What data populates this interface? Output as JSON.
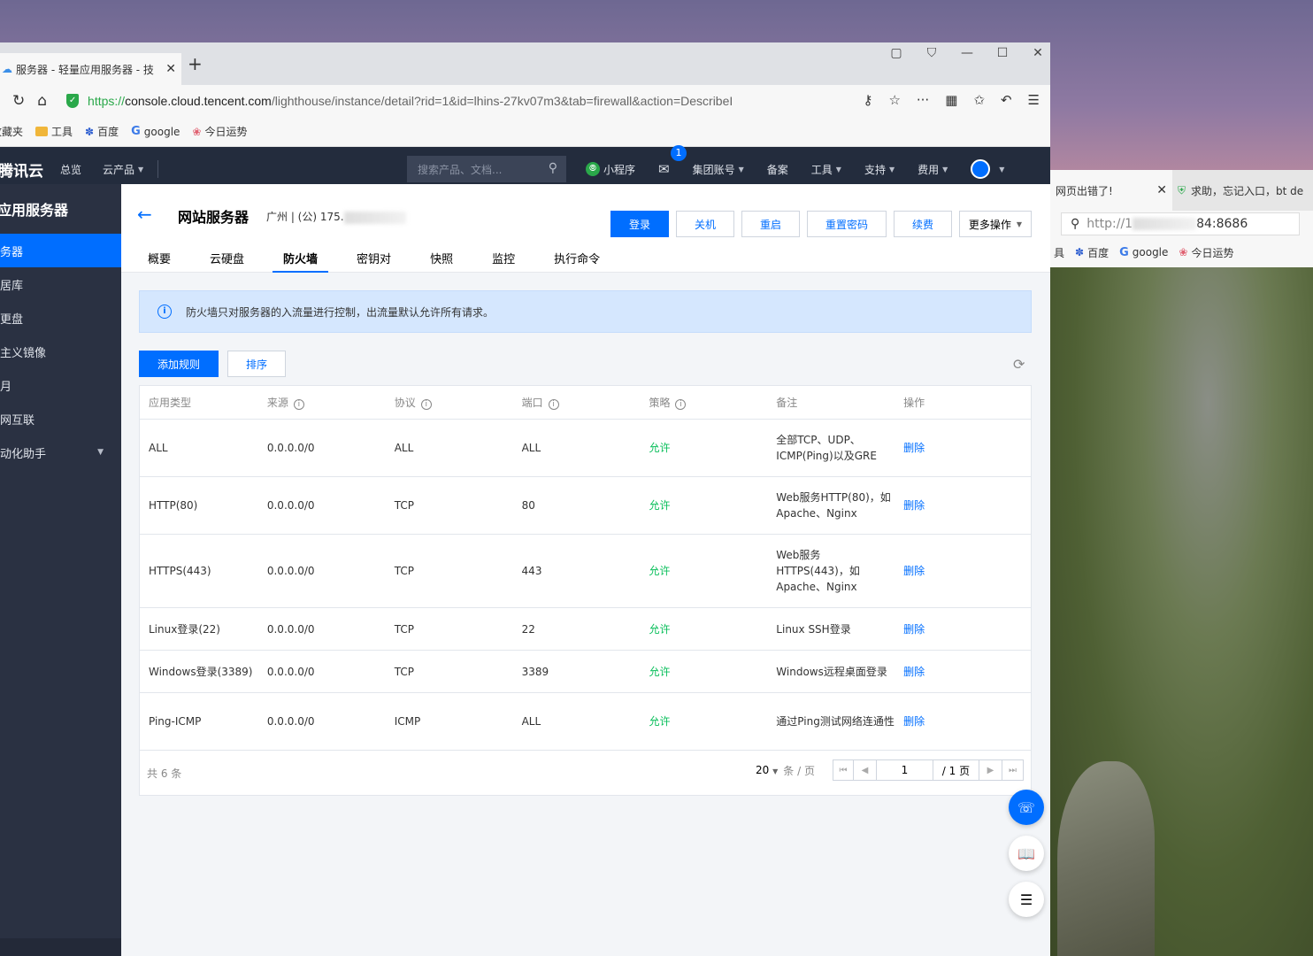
{
  "bg_browser": {
    "tabs": [
      {
        "label": "网页出错了!",
        "close": "✕"
      },
      {
        "label": "求助，忘记入口，bt de"
      }
    ],
    "url_start": "http://1",
    "url_end": "84:8686",
    "bookmarks": [
      "具",
      "百度",
      "google",
      "今日运势"
    ]
  },
  "browser": {
    "tab_title": "服务器 - 轻量应用服务器 - 技",
    "tab_close": "✕",
    "new_tab": "+",
    "url_protocol": "https://",
    "url_host": "console.cloud.tencent.com",
    "url_path": "/lighthouse/instance/detail?rid=1&id=lhins-27kv07m3&tab=firewall&action=DescribeI",
    "bookmarks": {
      "prefix": "收藏夹",
      "tools": "工具",
      "baidu": "百度",
      "google": "google",
      "fortune": "今日运势"
    }
  },
  "header": {
    "brand": "腾讯云",
    "overview": "总览",
    "products": "云产品",
    "search_placeholder": "搜索产品、文档...",
    "miniprogram": "小程序",
    "mail_badge": "1",
    "group_account": "集团账号",
    "icp": "备案",
    "tools": "工具",
    "support": "支持",
    "billing": "费用"
  },
  "sidebar": {
    "title": "应用服务器",
    "items": [
      {
        "label": "务器",
        "active": true
      },
      {
        "label": "居库"
      },
      {
        "label": "更盘"
      },
      {
        "label": "主义镜像"
      },
      {
        "label": "月"
      },
      {
        "label": "网互联"
      },
      {
        "label": "动化助手"
      }
    ]
  },
  "page": {
    "title": "网站服务器",
    "subtitle_prefix": "广州 | (公) 175.",
    "actions": [
      "登录",
      "关机",
      "重启",
      "重置密码",
      "续费",
      "更多操作"
    ],
    "tabs": [
      "概要",
      "云硬盘",
      "防火墙",
      "密钥对",
      "快照",
      "监控",
      "执行命令"
    ],
    "active_tab": "防火墙",
    "notice": "防火墙只对服务器的入流量进行控制，出流量默认允许所有请求。",
    "add_rule": "添加规则",
    "sort": "排序"
  },
  "table": {
    "headers": [
      "应用类型",
      "来源",
      "协议",
      "端口",
      "策略",
      "备注",
      "操作"
    ],
    "rows": [
      {
        "type": "ALL",
        "source": "0.0.0.0/0",
        "protocol": "ALL",
        "port": "ALL",
        "policy": "允许",
        "note": "全部TCP、UDP、ICMP(Ping)以及GRE",
        "op": "删除"
      },
      {
        "type": "HTTP(80)",
        "source": "0.0.0.0/0",
        "protocol": "TCP",
        "port": "80",
        "policy": "允许",
        "note": "Web服务HTTP(80)，如 Apache、Nginx",
        "op": "删除"
      },
      {
        "type": "HTTPS(443)",
        "source": "0.0.0.0/0",
        "protocol": "TCP",
        "port": "443",
        "policy": "允许",
        "note": "Web服务HTTPS(443)，如Apache、Nginx",
        "op": "删除"
      },
      {
        "type": "Linux登录(22)",
        "source": "0.0.0.0/0",
        "protocol": "TCP",
        "port": "22",
        "policy": "允许",
        "note": "Linux SSH登录",
        "op": "删除"
      },
      {
        "type": "Windows登录(3389)",
        "source": "0.0.0.0/0",
        "protocol": "TCP",
        "port": "3389",
        "policy": "允许",
        "note": "Windows远程桌面登录",
        "op": "删除"
      },
      {
        "type": "Ping-ICMP",
        "source": "0.0.0.0/0",
        "protocol": "ICMP",
        "port": "ALL",
        "policy": "允许",
        "note": "通过Ping测试网络连通性",
        "op": "删除"
      }
    ],
    "total": "共 6 条",
    "page_size": "20",
    "per_page_unit": "条 / 页",
    "current_page": "1",
    "total_pages": "/ 1 页"
  },
  "colors": {
    "primary": "#006eff",
    "allow": "#0abf5b",
    "header_bg": "#232c3d",
    "sidebar_bg": "#2a3142"
  }
}
